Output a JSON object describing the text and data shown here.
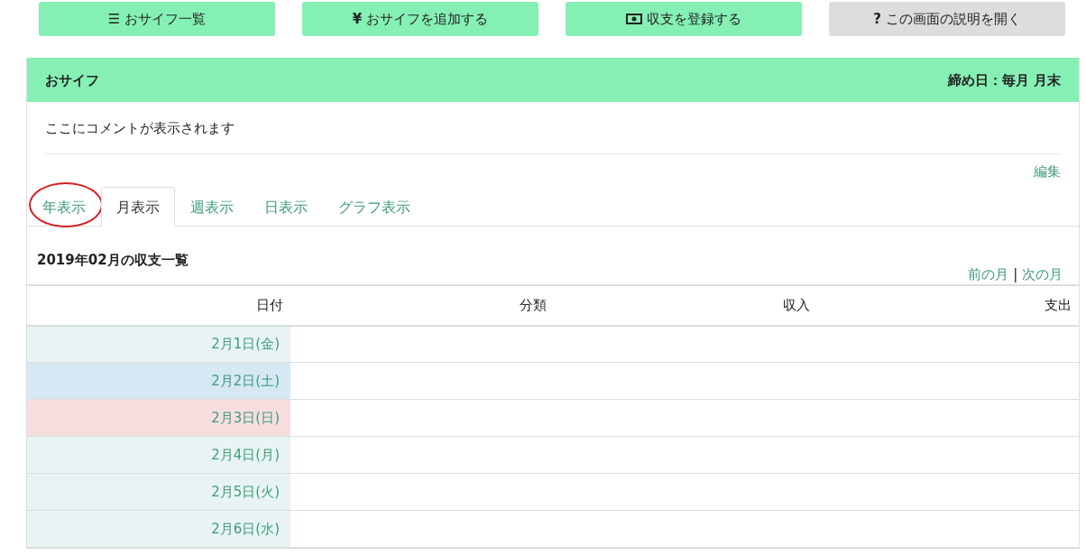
{
  "toolbar": [
    {
      "kind": "green",
      "glyph": "☰",
      "label": "おサイフ一覧"
    },
    {
      "kind": "green",
      "glyph": "¥",
      "label": "おサイフを追加する"
    },
    {
      "kind": "green",
      "label": "収支を登録する"
    },
    {
      "kind": "grey",
      "glyph": "?",
      "label": "この画面の説明を開く"
    }
  ],
  "wallet": {
    "title": "おサイフ",
    "closing_day": "締め日：毎月 月末",
    "comment": "ここにコメントが表示されます",
    "edit_link": "編集"
  },
  "tabs": [
    {
      "label": "年表示",
      "selected": false,
      "circled": true
    },
    {
      "label": "月表示",
      "selected": true,
      "circled": false
    },
    {
      "label": "週表示",
      "selected": false,
      "circled": false
    },
    {
      "label": "日表示",
      "selected": false,
      "circled": false
    },
    {
      "label": "グラフ表示",
      "selected": false,
      "circled": false
    }
  ],
  "list": {
    "title": "2019年02月の収支一覧",
    "prev_link": "前の月",
    "separator": "|",
    "next_link": "次の月"
  },
  "table": {
    "columns": [
      "日付",
      "分類",
      "収入",
      "支出"
    ],
    "rows": [
      {
        "date": "2月1日(金)",
        "kind": "weekday"
      },
      {
        "date": "2月2日(土)",
        "kind": "saturday"
      },
      {
        "date": "2月3日(日)",
        "kind": "sunday"
      },
      {
        "date": "2月4日(月)",
        "kind": "weekday"
      },
      {
        "date": "2月5日(火)",
        "kind": "weekday"
      },
      {
        "date": "2月6日(水)",
        "kind": "weekday"
      }
    ]
  }
}
